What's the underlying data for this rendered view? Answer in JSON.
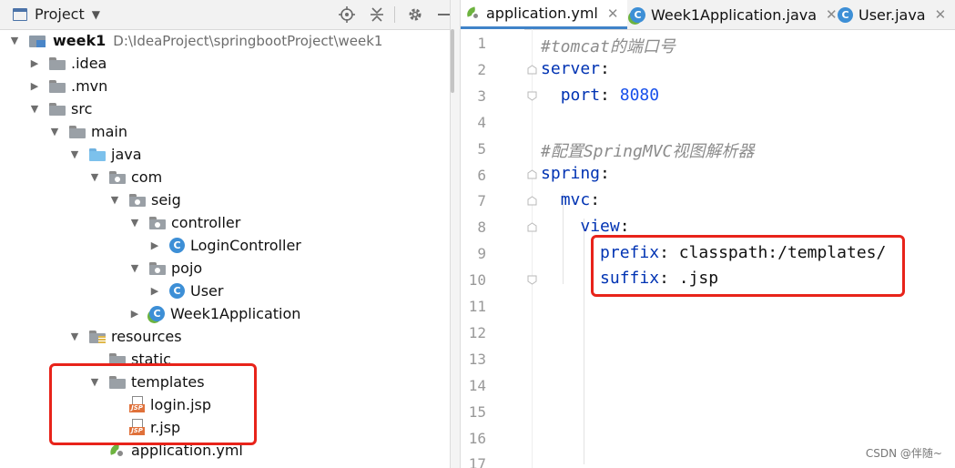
{
  "project_panel": {
    "title": "Project",
    "toolbar_icons": [
      "locate-icon",
      "collapse-icon",
      "gear-icon",
      "minimize-icon"
    ]
  },
  "tree": {
    "root": {
      "name": "week1",
      "path": "D:\\IdeaProject\\springbootProject\\week1"
    },
    "items": [
      {
        "label": ".idea"
      },
      {
        "label": ".mvn"
      },
      {
        "label": "src"
      },
      {
        "label": "main"
      },
      {
        "label": "java"
      },
      {
        "label": "com"
      },
      {
        "label": "seig"
      },
      {
        "label": "controller"
      },
      {
        "label": "LoginController"
      },
      {
        "label": "pojo"
      },
      {
        "label": "User"
      },
      {
        "label": "Week1Application"
      },
      {
        "label": "resources"
      },
      {
        "label": "static"
      },
      {
        "label": "templates"
      },
      {
        "label": "login.jsp"
      },
      {
        "label": "r.jsp"
      },
      {
        "label": "application.yml"
      }
    ],
    "class_icon_letter": "C",
    "jsp_icon_label": "JSP"
  },
  "editor": {
    "tabs": [
      {
        "label": "application.yml",
        "active": true
      },
      {
        "label": "Week1Application.java",
        "active": false
      },
      {
        "label": "User.java",
        "active": false
      }
    ],
    "line_numbers": [
      "1",
      "2",
      "3",
      "4",
      "5",
      "6",
      "7",
      "8",
      "9",
      "10",
      "11",
      "12",
      "13",
      "14",
      "15",
      "16",
      "17"
    ],
    "code": {
      "l1": "#tomcat的端口号",
      "l2_key": "server",
      "l3_key": "port",
      "l3_val": "8080",
      "l5": "#配置SpringMVC视图解析器",
      "l6_key": "spring",
      "l7_key": "mvc",
      "l8_key": "view",
      "l9_key": "prefix",
      "l9_val": "classpath:/templates/",
      "l10_key": "suffix",
      "l10_val": ".jsp",
      "colon": ":"
    }
  },
  "watermark": "CSDN @伴随~",
  "colors": {
    "highlight_box": "#e8231a",
    "yaml_key": "#0033b3",
    "yaml_number": "#1750eb",
    "comment": "#8c8c8c",
    "active_tab_underline": "#4083c9"
  }
}
